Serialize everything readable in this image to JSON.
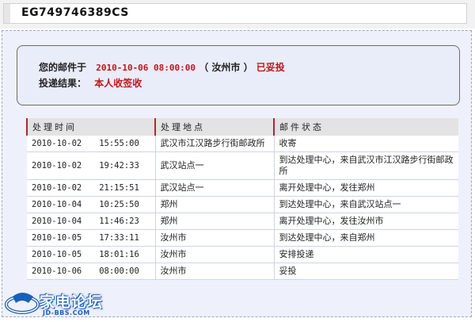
{
  "header": {
    "tracking_number": "EG749746389CS"
  },
  "summary": {
    "line1_label": "您的邮件于",
    "line1_datetime": "2010-10-06 08:00:00",
    "line1_location": "（ 汝州市 ）",
    "line1_status": "已妥投",
    "line2_label": "投递结果：",
    "line2_value": "本人收签收"
  },
  "table": {
    "headers": [
      "处理时间",
      "处理地点",
      "邮件状态"
    ],
    "rows": [
      {
        "date": "2010-10-02",
        "time": "15:55:00",
        "location": "武汉市江汉路步行街邮政所",
        "status": "收寄"
      },
      {
        "date": "2010-10-02",
        "time": "19:42:33",
        "location": "武汉站点一",
        "status": "到达处理中心，来自武汉市江汉路步行街邮政所"
      },
      {
        "date": "2010-10-02",
        "time": "21:15:51",
        "location": "武汉站点一",
        "status": "离开处理中心，发往郑州"
      },
      {
        "date": "2010-10-04",
        "time": "10:25:50",
        "location": "郑州",
        "status": "到达处理中心，来自武汉站点一"
      },
      {
        "date": "2010-10-04",
        "time": "11:46:23",
        "location": "郑州",
        "status": "离开处理中心，发往汝州市"
      },
      {
        "date": "2010-10-05",
        "time": "17:33:11",
        "location": "汝州市",
        "status": "到达处理中心，来自郑州"
      },
      {
        "date": "2010-10-05",
        "time": "18:01:16",
        "location": "汝州市",
        "status": "安排投递"
      },
      {
        "date": "2010-10-06",
        "time": "08:00:00",
        "location": "汝州市",
        "status": "妥投"
      }
    ]
  },
  "watermark": {
    "title": "家电论坛",
    "url": "JD-BBS.COM"
  },
  "colors": {
    "accent_red": "#c4141b",
    "panel_bg": "#eef1fb",
    "watermark_blue": "#1a5fb8"
  }
}
